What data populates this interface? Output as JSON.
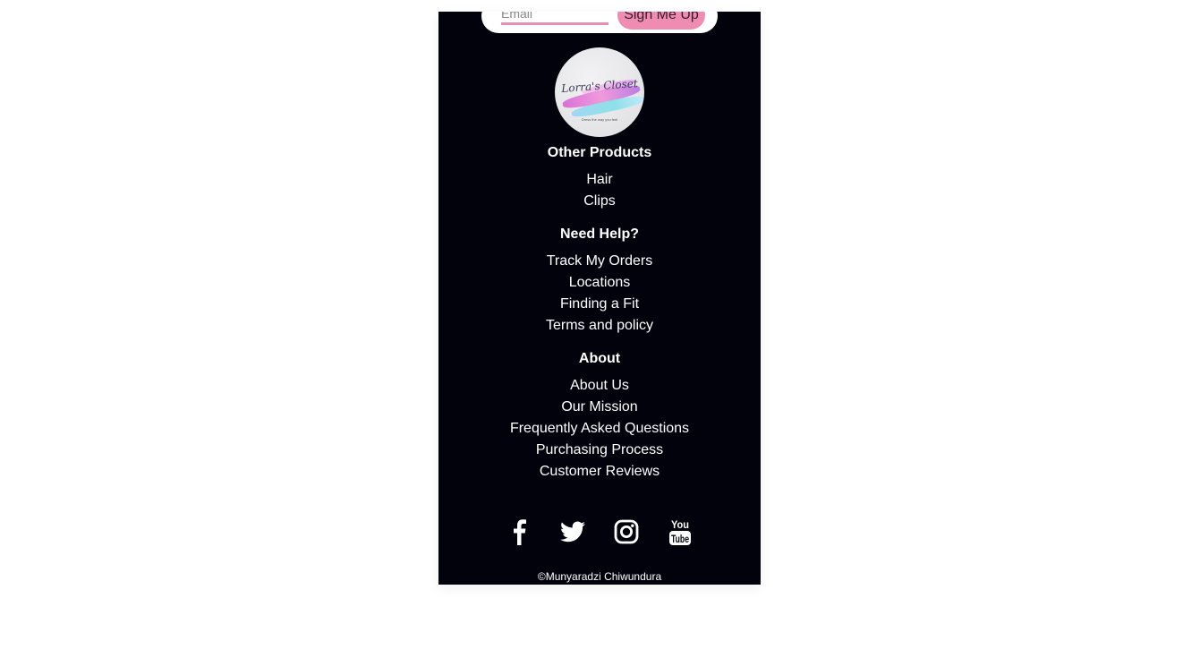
{
  "signup": {
    "email_placeholder": "Email",
    "button_label": "Sign Me Up"
  },
  "brand": {
    "logo_text": "Lorra's Closet",
    "logo_tagline": "Dress the way you feel"
  },
  "footer": {
    "sections": [
      {
        "title": "Other Products",
        "links": [
          "Hair",
          "Clips"
        ]
      },
      {
        "title": "Need Help?",
        "links": [
          "Track My Orders",
          "Locations",
          "Finding a Fit",
          "Terms and policy"
        ]
      },
      {
        "title": "About",
        "links": [
          "About Us",
          "Our Mission",
          "Frequently Asked Questions",
          "Purchasing Process",
          "Customer Reviews"
        ]
      }
    ],
    "social_icons": [
      "facebook-icon",
      "twitter-icon",
      "instagram-icon",
      "youtube-icon"
    ],
    "copyright": "©Munyaradzi Chiwundura"
  },
  "colors": {
    "footer_bg": "#02020d",
    "accent_pink": "#ee8db1"
  }
}
